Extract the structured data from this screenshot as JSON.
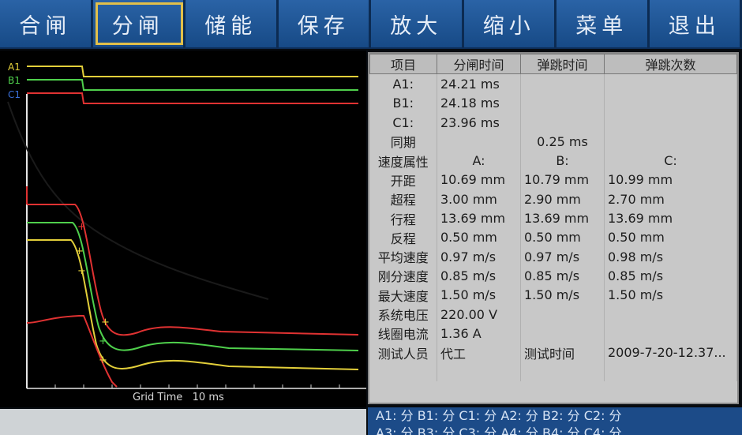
{
  "toolbar": [
    {
      "label": "合闸",
      "active": false
    },
    {
      "label": "分闸",
      "active": true
    },
    {
      "label": "储能",
      "active": false
    },
    {
      "label": "保存",
      "active": false
    },
    {
      "label": "放大",
      "active": false
    },
    {
      "label": "缩小",
      "active": false
    },
    {
      "label": "菜单",
      "active": false
    },
    {
      "label": "退出",
      "active": false
    }
  ],
  "plot": {
    "channels": [
      {
        "name": "A1",
        "color": "#e3cf3a"
      },
      {
        "name": "B1",
        "color": "#4fd04c"
      },
      {
        "name": "C1",
        "color": "#3a6fd8"
      }
    ],
    "grid_time_label": "Grid Time",
    "grid_time_value": "10 ms"
  },
  "table": {
    "headers": [
      "项目",
      "分闸时间",
      "弹跳时间",
      "弹跳次数"
    ],
    "rows": [
      [
        "A1:",
        "24.21 ms",
        "",
        ""
      ],
      [
        "B1:",
        "24.18 ms",
        "",
        ""
      ],
      [
        "C1:",
        "23.96 ms",
        "",
        ""
      ],
      [
        "同期",
        "",
        "0.25 ms",
        ""
      ],
      [
        "速度属性",
        "A:",
        "B:",
        "C:"
      ],
      [
        "开距",
        "10.69 mm",
        "10.79 mm",
        "10.99 mm"
      ],
      [
        "超程",
        "3.00 mm",
        "2.90 mm",
        "2.70 mm"
      ],
      [
        "行程",
        "13.69 mm",
        "13.69 mm",
        "13.69 mm"
      ],
      [
        "反程",
        "0.50 mm",
        "0.50 mm",
        "0.50 mm"
      ],
      [
        "平均速度",
        "0.97 m/s",
        "0.97 m/s",
        "0.98 m/s"
      ],
      [
        "刚分速度",
        "0.85 m/s",
        "0.85 m/s",
        "0.85 m/s"
      ],
      [
        "最大速度",
        "1.50 m/s",
        "1.50 m/s",
        "1.50 m/s"
      ],
      [
        "系统电压",
        "220.00 V",
        "",
        ""
      ],
      [
        "线圈电流",
        "1.36 A",
        "",
        ""
      ],
      [
        "测试人员",
        "代工",
        "测试时间",
        "2009-7-20-12.37..."
      ],
      [
        "",
        "",
        "",
        ""
      ]
    ]
  },
  "status": {
    "line1": "A1: 分 B1: 分 C1: 分 A2: 分 B2: 分 C2: 分",
    "line2": "A3: 分 B3: 分 C3: 分 A4: 分 B4: 分 C4: 分"
  }
}
